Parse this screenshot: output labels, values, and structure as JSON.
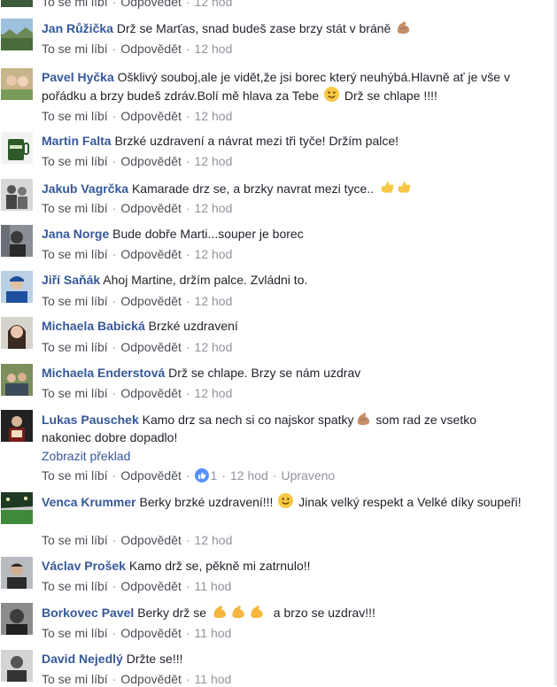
{
  "actions": {
    "like": "To se mi líbí",
    "reply": "Odpovědět",
    "translate": "Zobrazit překlad",
    "edited": "Upraveno",
    "separator": "·"
  },
  "comments": [
    {
      "author": "",
      "text_before": "",
      "emoji": "",
      "text_after": "",
      "time": "12 hod"
    },
    {
      "author": "Jan Růžička",
      "text_before": "Drž se Marťas, snad budeš zase brzy stát v bráně ",
      "emoji": "muscle-emoji",
      "text_after": "",
      "time": "12 hod"
    },
    {
      "author": "Pavel Hyčka",
      "text_before": "Ošklivý souboj,ale je vidět,že jsi borec který neuhýbá.Hlavně ať je vše v pořádku a brzy budeš zdráv.Bolí mě hlava za Tebe ",
      "emoji": "smile-emoji",
      "text_after": " Drž se chlape !!!!",
      "time": "12 hod"
    },
    {
      "author": "Martin Falta",
      "text_before": "Brzké uzdravení a návrat mezi tři tyče! Držím palce!",
      "time": "12 hod"
    },
    {
      "author": "Jakub Vagrčka",
      "text_before": "Kamarade drz se, a brzky navrat mezi tyce.. ",
      "emoji": "thumbs-up-emoji",
      "text_after": "",
      "time": "12 hod"
    },
    {
      "author": "Jana Norge",
      "text_before": "Bude dobře Marti...souper je borec",
      "time": "12 hod"
    },
    {
      "author": "Jiří Saňák",
      "text_before": "Ahoj Martine, držím palce. Zvládni to.",
      "time": "12 hod"
    },
    {
      "author": "Michaela Babická",
      "text_before": "Brzké uzdravení",
      "time": "12 hod"
    },
    {
      "author": "Michaela Enderstová",
      "text_before": "Drž se chlape. Brzy se nám uzdrav",
      "time": "12 hod"
    },
    {
      "author": "Lukas Pauschek",
      "text_before": "Kamo drz sa nech si co najskor spatky",
      "emoji": "muscle-emoji",
      "text_after": " som rad ze vsetko nakoniec dobre dopadlo!",
      "time": "12 hod",
      "likes": "1"
    },
    {
      "author": "Venca Krummer",
      "text_before": "Berky brzké uzdravení!!! ",
      "emoji": "smile-emoji",
      "text_after": " Jinak velký respekt a Velké díky soupeři!",
      "time": "12 hod"
    },
    {
      "author": "Václav Prošek",
      "text_before": "Kamo drž se, pěkně mi zatrnulo!!",
      "time": "11 hod"
    },
    {
      "author": "Borkovec Pavel",
      "text_before": "Berky drž se ",
      "emoji": "muscle-emoji",
      "text_after": " a brzo se uzdrav!!!",
      "time": "11 hod"
    },
    {
      "author": "David Nejedlý",
      "text_before": "Držte se!!!",
      "time": "11 hod"
    }
  ]
}
